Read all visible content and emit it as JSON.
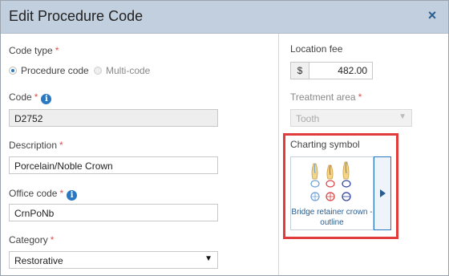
{
  "dialog": {
    "title": "Edit Procedure Code",
    "close_label": "×"
  },
  "left": {
    "code_type": {
      "label": "Code type",
      "required_mark": "*",
      "options": [
        "Procedure code",
        "Multi-code"
      ],
      "selected": "Procedure code"
    },
    "code": {
      "label": "Code",
      "required_mark": "*",
      "info_icon": "i",
      "value": "D2752"
    },
    "description": {
      "label": "Description",
      "required_mark": "*",
      "value": "Porcelain/Noble Crown"
    },
    "office_code": {
      "label": "Office code",
      "required_mark": "*",
      "info_icon": "i",
      "value": "CrnPoNb"
    },
    "category": {
      "label": "Category",
      "required_mark": "*",
      "value": "Restorative"
    }
  },
  "right": {
    "location_fee": {
      "label": "Location fee",
      "currency": "$",
      "value": "482.00"
    },
    "treatment_area": {
      "label": "Treatment area",
      "required_mark": "*",
      "value": "Tooth"
    },
    "charting_symbol": {
      "label": "Charting symbol",
      "caption": "Bridge retainer crown - outline"
    }
  },
  "colors": {
    "title_bar": "#c2cfdf",
    "accent": "#2a78c2",
    "required": "#d9534f",
    "highlight": "#e03c3c"
  }
}
